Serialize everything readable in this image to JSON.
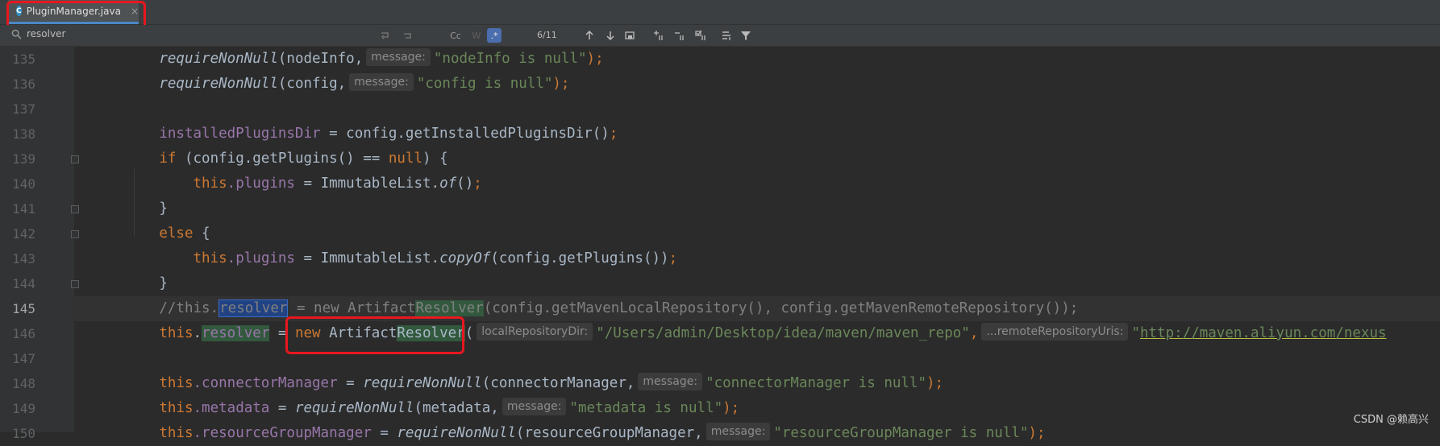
{
  "tab": {
    "filename": "PluginManager.java",
    "close": "×",
    "icon_letter": "C"
  },
  "findbar": {
    "query": "resolver",
    "match_case_label": "Cc",
    "words_label": "W",
    "regex_label": ".*",
    "matches": "6/11"
  },
  "line_numbers": [
    "135",
    "136",
    "137",
    "138",
    "139",
    "140",
    "141",
    "142",
    "143",
    "144",
    "145",
    "146",
    "147",
    "148",
    "149",
    "150"
  ],
  "current_line": "145",
  "code": {
    "l135": {
      "method": "requireNonNull",
      "arg": "(nodeInfo,",
      "hint": "message:",
      "str": "\"nodeInfo is null\"",
      "end": ");"
    },
    "l136": {
      "method": "requireNonNull",
      "arg": "(config,",
      "hint": "message:",
      "str": "\"config is null\"",
      "end": ");"
    },
    "l138": {
      "field": "installedPluginsDir",
      "rest": " = config.getInstalledPluginsDir()",
      "end": ";"
    },
    "l139": {
      "kw": "if",
      "rest1": " (config.getPlugins() == ",
      "kw2": "null",
      "rest2": ") {"
    },
    "l140": {
      "this": "this",
      "field": ".plugins",
      "rest": " = ImmutableList.",
      "method": "of",
      "rest2": "()",
      "end": ";"
    },
    "l141": {
      "text": "}"
    },
    "l142": {
      "kw": "else",
      "rest": " {"
    },
    "l143": {
      "this": "this",
      "field": ".plugins",
      "rest": " = ImmutableList.",
      "method": "copyOf",
      "rest2": "(config.getPlugins())",
      "end": ";"
    },
    "l144": {
      "text": "}"
    },
    "l145": {
      "c1": "//this.",
      "sel": "resolver",
      "c2": " = new Artifact",
      "match": "Resolver",
      "c3": "(config.getMavenLocalRepository(), config.getMavenRemoteRepository());"
    },
    "l146": {
      "this": "this",
      "dot": ".",
      "field": "resolver",
      "eq": " = ",
      "kw": "new",
      "cls": " Artifact",
      "match": "Resolver",
      "paren": "(",
      "hint1": "localRepositoryDir:",
      "str1": "\"/Users/admin/Desktop/idea/maven/maven_repo\"",
      "comma": ",",
      "hint2": "...remoteRepositoryUris:",
      "str2a": "\"",
      "url": "http://maven.aliyun.com/nexus"
    },
    "l148": {
      "this": "this",
      "field": ".connectorManager",
      "rest": " = ",
      "method": "requireNonNull",
      "arg": "(connectorManager,",
      "hint": "message:",
      "str": "\"connectorManager is null\"",
      "end": ");"
    },
    "l149": {
      "this": "this",
      "field": ".metadata",
      "rest": " = ",
      "method": "requireNonNull",
      "arg": "(metadata,",
      "hint": "message:",
      "str": "\"metadata is null\"",
      "end": ");"
    },
    "l150": {
      "this": "this",
      "field": ".resourceGroupManager",
      "rest": " = ",
      "method": "requireNonNull",
      "arg": "(resourceGroupManager,",
      "hint": "message:",
      "str": "\"resourceGroupManager is null\"",
      "end": ");"
    }
  },
  "watermark": "CSDN @赖高兴",
  "colors": {
    "keyword": "#cc7832",
    "field": "#9876aa",
    "string": "#6a8759",
    "comment": "#808080",
    "highlight_box": "#e8171e"
  }
}
